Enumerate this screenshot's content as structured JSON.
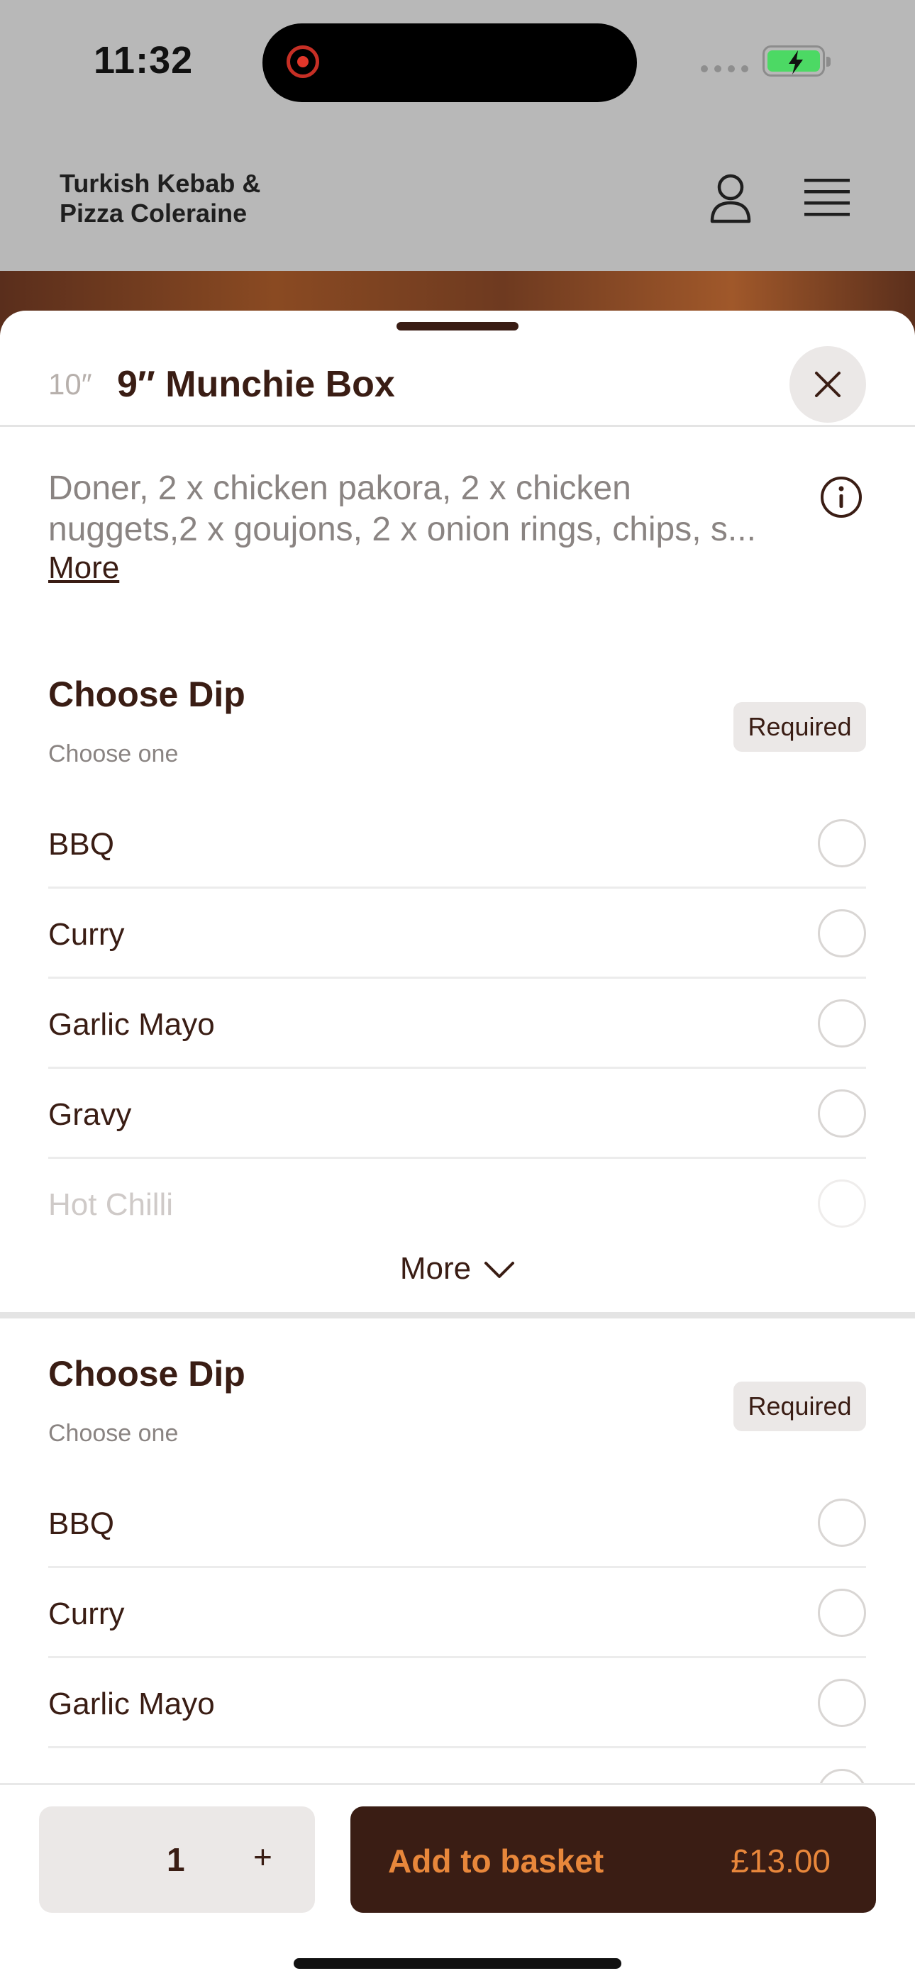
{
  "status_bar": {
    "time": "11:32"
  },
  "header": {
    "brand": "Turkish Kebab & Pizza Coleraine"
  },
  "item": {
    "size_label": "10″",
    "title": "9″ Munchie Box",
    "description_line1": "Doner, 2 x chicken pakora, 2 x chicken",
    "description_line2": "nuggets,2 x goujons, 2 x onion rings, chips, s...",
    "more_link": "More"
  },
  "sections": [
    {
      "title": "Choose Dip",
      "subtitle": "Choose one",
      "badge": "Required",
      "options": [
        "BBQ",
        "Curry",
        "Garlic Mayo",
        "Gravy",
        "Hot Chilli"
      ],
      "more_label": "More"
    },
    {
      "title": "Choose Dip",
      "subtitle": "Choose one",
      "badge": "Required",
      "options": [
        "BBQ",
        "Curry",
        "Garlic Mayo"
      ]
    }
  ],
  "footer": {
    "quantity": "1",
    "plus": "+",
    "add_label": "Add to basket",
    "price": "£13.00"
  },
  "colors": {
    "accent": "#e8873b",
    "brand_dark": "#3a1d14",
    "badge_bg": "#ebe8e7"
  }
}
